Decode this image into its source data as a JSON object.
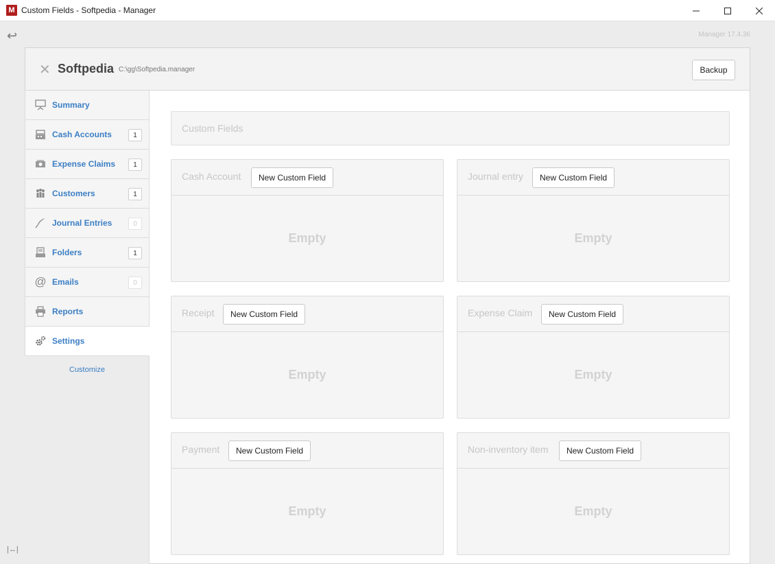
{
  "window": {
    "app_icon_letter": "M",
    "title": "Custom Fields - Softpedia - Manager",
    "controls": [
      "minimize-icon",
      "maximize-icon",
      "close-icon"
    ]
  },
  "version": "Manager 17.4.36",
  "header": {
    "business_name": "Softpedia",
    "business_path": "C:\\gg\\Softpedia.manager",
    "backup_label": "Backup"
  },
  "sidebar": {
    "items": [
      {
        "label": "Summary",
        "count": "",
        "icon": "presentation-icon"
      },
      {
        "label": "Cash Accounts",
        "count": "1",
        "icon": "cash-register-icon"
      },
      {
        "label": "Expense Claims",
        "count": "1",
        "icon": "money-icon"
      },
      {
        "label": "Customers",
        "count": "1",
        "icon": "people-icon"
      },
      {
        "label": "Journal Entries",
        "count": "0",
        "icon": "quill-icon"
      },
      {
        "label": "Folders",
        "count": "1",
        "icon": "folder-stack-icon"
      },
      {
        "label": "Emails",
        "count": "0",
        "icon": "at-sign-icon"
      },
      {
        "label": "Reports",
        "count": "",
        "icon": "printer-icon"
      },
      {
        "label": "Settings",
        "count": "",
        "icon": "gears-icon"
      }
    ],
    "customize_label": "Customize"
  },
  "main": {
    "section_title": "Custom Fields",
    "cards": [
      {
        "title": "Cash Account",
        "button": "New Custom Field",
        "empty": "Empty"
      },
      {
        "title": "Journal entry",
        "button": "New Custom Field",
        "empty": "Empty"
      },
      {
        "title": "Receipt",
        "button": "New Custom Field",
        "empty": "Empty"
      },
      {
        "title": "Expense Claim",
        "button": "New Custom Field",
        "empty": "Empty"
      },
      {
        "title": "Payment",
        "button": "New Custom Field",
        "empty": "Empty"
      },
      {
        "title": "Non-inventory item",
        "button": "New Custom Field",
        "empty": "Empty"
      }
    ]
  },
  "colors": {
    "link": "#3b7fc4",
    "app_icon": "#b01e1e",
    "muted_text": "#c6c6c6"
  }
}
